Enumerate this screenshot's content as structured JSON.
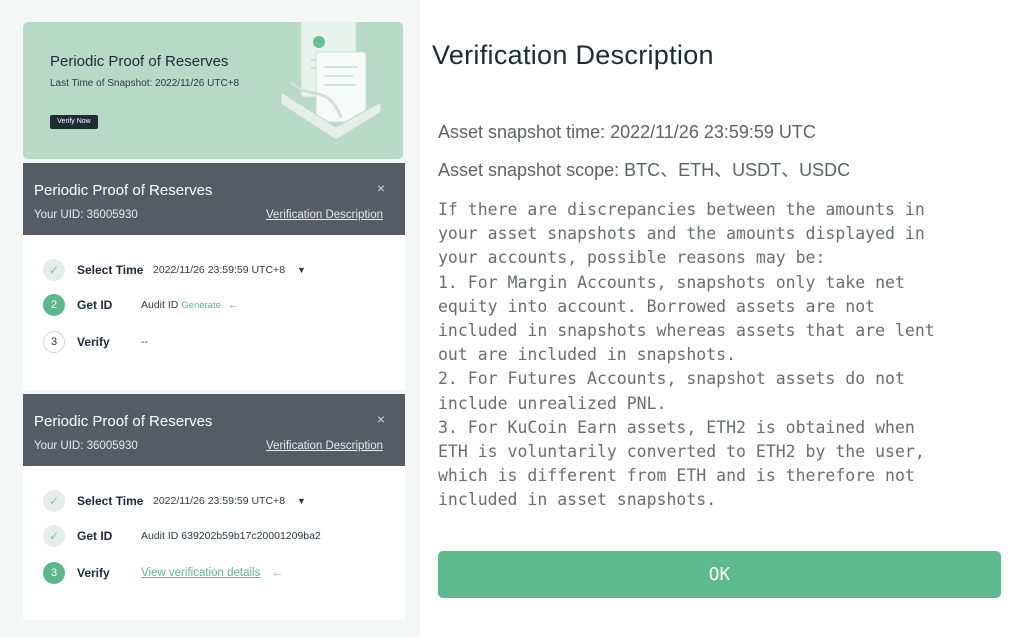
{
  "banner": {
    "title": "Periodic Proof of Reserves",
    "snapshot_label": "Last Time of Snapshot: 2022/11/26 UTC+8",
    "verify_button": "Verify Now"
  },
  "cards": [
    {
      "title": "Periodic Proof of Reserves",
      "uid": "Your UID: 36005930",
      "link": "Verification Description",
      "close": "×",
      "steps": [
        {
          "marker": "✓",
          "label": "Select Time",
          "value": "2022/11/26 23:59:59 UTC+8",
          "caret": "▼"
        },
        {
          "marker": "2",
          "label": "Get ID",
          "value": "Audit ID",
          "action": "Generate",
          "arrow": "←"
        },
        {
          "marker": "3",
          "label": "Verify",
          "value": "--"
        }
      ]
    },
    {
      "title": "Periodic Proof of Reserves",
      "uid": "Your UID: 36005930",
      "link": "Verification Description",
      "close": "×",
      "steps": [
        {
          "marker": "✓",
          "label": "Select Time",
          "value": "2022/11/26 23:59:59 UTC+8",
          "caret": "▼"
        },
        {
          "marker": "✓",
          "label": "Get ID",
          "value": "Audit ID 639202b59b17c20001209ba2"
        },
        {
          "marker": "3",
          "label": "Verify",
          "action": "View verification details",
          "arrow": "←"
        }
      ]
    }
  ],
  "dialog": {
    "title": "Verification Description",
    "snapshot_time": "Asset snapshot time: 2022/11/26 23:59:59 UTC",
    "snapshot_scope": "Asset snapshot scope: BTC、ETH、USDT、USDC",
    "description": "If there are discrepancies between the amounts in\nyour asset snapshots and the amounts displayed in\nyour accounts, possible reasons may be:\n1. For Margin Accounts, snapshots only take net\nequity into account. Borrowed assets are not\nincluded in snapshots whereas assets that are lent\nout are included in snapshots.\n2. For Futures Accounts, snapshot assets do not\ninclude unrealized PNL.\n3. For KuCoin Earn assets, ETH2 is obtained when\nETH is voluntarily converted to ETH2 by the user,\nwhich is different from ETH and is therefore not\nincluded in asset snapshots.",
    "ok_button": "OK"
  },
  "colors": {
    "accent": "#5eb98f",
    "banner_bg": "#b9d9c8",
    "card_header": "#555c64"
  }
}
